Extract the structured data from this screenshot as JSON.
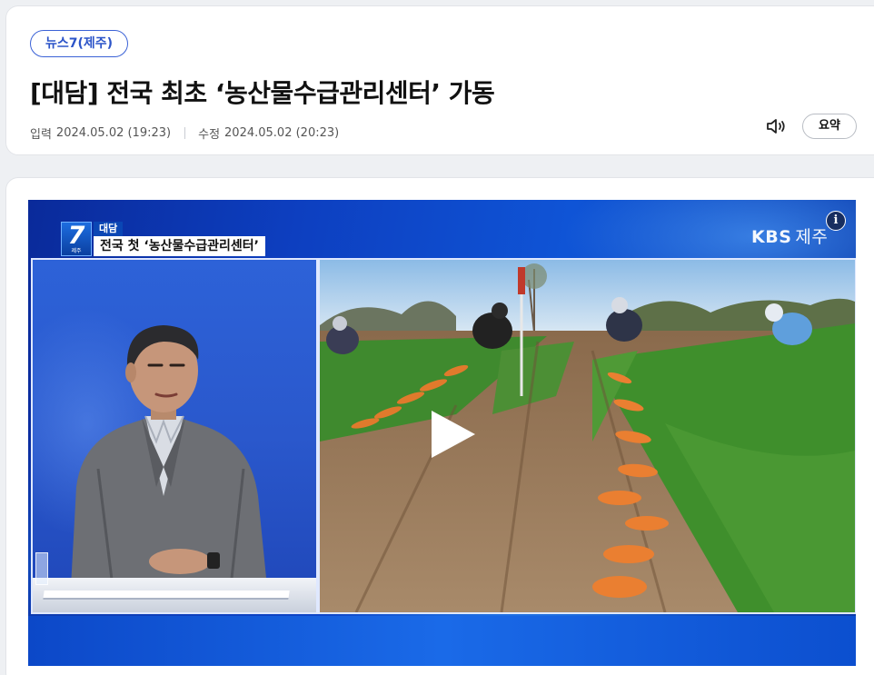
{
  "article": {
    "category": "뉴스7(제주)",
    "title": "[대담] 전국 최초 ‘농산물수급관리센터’ 가동",
    "input_label": "입력",
    "input_date": "2024.05.02 (19:23)",
    "modified_label": "수정",
    "modified_date": "2024.05.02 (20:23)",
    "audio_icon": "speaker-icon",
    "summary_label": "요약"
  },
  "video": {
    "info_icon": "info-icon",
    "info_label": "i",
    "broadcaster": "KBS",
    "broadcaster_region": "제주",
    "program_number": "7",
    "program_region": "제주",
    "caption_tag": "대담",
    "caption_text": "전국 첫 ‘농산물수급관리센터’",
    "play_icon": "play-icon",
    "colors": {
      "background": "#0f54d6",
      "caption_tag": "#0a46b4"
    }
  },
  "colors": {
    "accent": "#2c54c8",
    "page_background": "#eef0f3"
  }
}
